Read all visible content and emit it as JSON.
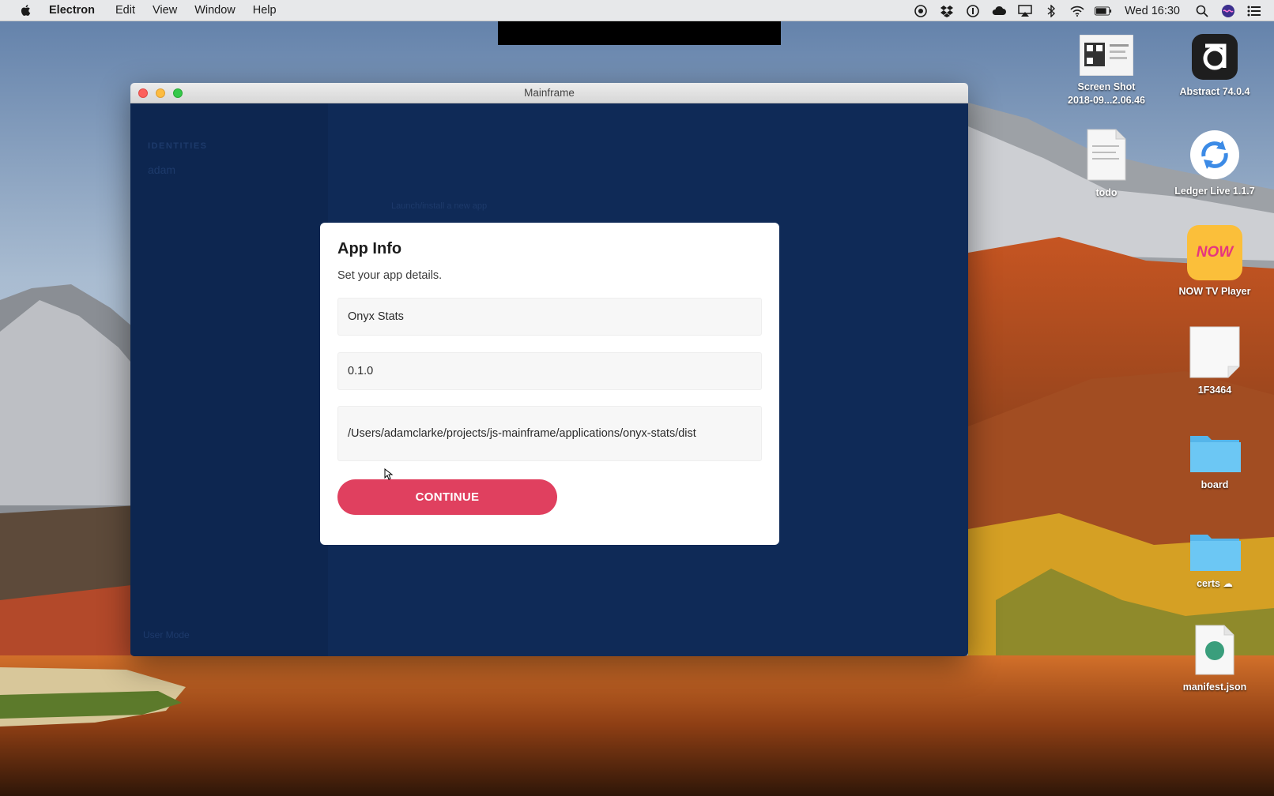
{
  "menubar": {
    "apple_icon": "apple-logo-icon",
    "app_name": "Electron",
    "items": [
      "Edit",
      "View",
      "Window",
      "Help"
    ],
    "status_icons": [
      "screen-record-icon",
      "dropbox-icon",
      "1password-icon",
      "cloud-app-icon",
      "airplay-icon",
      "bluetooth-icon",
      "wifi-icon",
      "battery-icon"
    ],
    "clock": "Wed 16:30",
    "search_icon": "spotlight-search-icon",
    "user_icon": "siri-icon",
    "notification_icon": "notification-center-icon"
  },
  "desktop": {
    "icons": [
      {
        "label": "Screen Shot\n2018-09...2.06.46",
        "icon": "screenshot-thumbnail-icon"
      },
      {
        "label": "Abstract 74.0.4",
        "icon": "abstract-app-icon"
      },
      {
        "label": "todo",
        "icon": "document-icon"
      },
      {
        "label": "Ledger Live 1.1.7",
        "icon": "ledger-live-icon"
      },
      {
        "label": "NOW TV Player",
        "icon": "now-tv-icon"
      },
      {
        "label": "1F3464",
        "icon": "blank-document-icon"
      },
      {
        "label": "board",
        "icon": "folder-icon"
      },
      {
        "label": "certs ☁",
        "icon": "folder-icon"
      },
      {
        "label": "manifest.json",
        "icon": "json-file-icon"
      }
    ],
    "now_tv_badge": "NOW"
  },
  "window": {
    "title": "Mainframe",
    "background_text": {
      "sidebar_heading": "IDENTITIES",
      "sidebar_user": "adam",
      "center_hint": "Launch/install a new app",
      "footer": "User Mode"
    }
  },
  "modal": {
    "title": "App Info",
    "subtitle": "Set your app details.",
    "name_value": "Onyx Stats",
    "version_value": "0.1.0",
    "path_value": "/Users/adamclarke/projects/js-mainframe/applications/onyx-stats/dist",
    "continue_label": "CONTINUE"
  },
  "colors": {
    "app_background": "#0f2a57",
    "accent": "#e0405f",
    "modal_background": "#ffffff"
  }
}
